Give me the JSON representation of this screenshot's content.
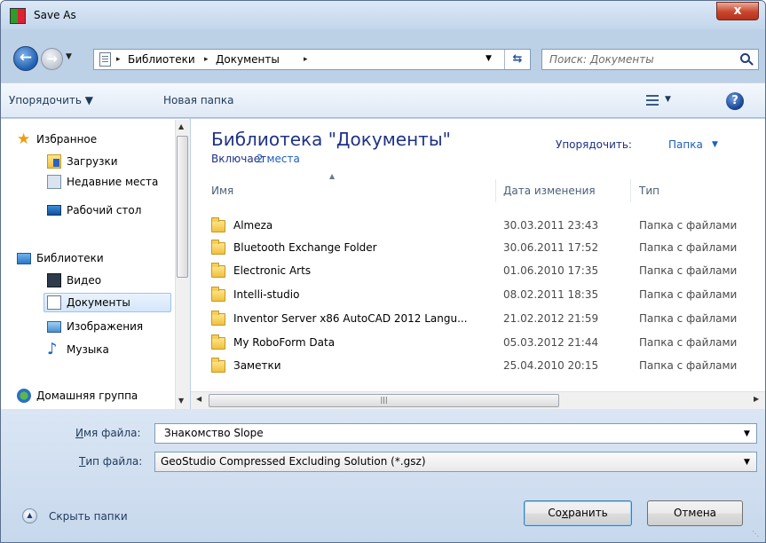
{
  "window": {
    "title": "Save As",
    "close_glyph": "x"
  },
  "address": {
    "crumbs": [
      "Библиотеки",
      "Документы"
    ],
    "sep": "▸",
    "search_placeholder": "Поиск: Документы"
  },
  "toolbar": {
    "organize": "Упорядочить ▼",
    "new_folder": "Новая папка",
    "help": "?"
  },
  "nav": {
    "favorites_header": "Избранное",
    "favorites": [
      "Загрузки",
      "Недавние места",
      "Рабочий стол"
    ],
    "libraries_header": "Библиотеки",
    "libraries": [
      "Видео",
      "Документы",
      "Изображения",
      "Музыка"
    ],
    "homegroup": "Домашняя группа",
    "selected": "Документы"
  },
  "library": {
    "title": "Библиотека \"Документы\"",
    "includes_label": "Включает:",
    "includes_count": "2 места",
    "arrange_label": "Упорядочить:",
    "arrange_value": "Папка"
  },
  "columns": {
    "name": "Имя",
    "date": "Дата изменения",
    "type": "Тип"
  },
  "rows": [
    {
      "name": "Almeza",
      "date": "30.03.2011 23:43",
      "type": "Папка с файлами"
    },
    {
      "name": "Bluetooth Exchange Folder",
      "date": "30.06.2011 17:52",
      "type": "Папка с файлами"
    },
    {
      "name": "Electronic Arts",
      "date": "01.06.2010 17:35",
      "type": "Папка с файлами"
    },
    {
      "name": "Intelli-studio",
      "date": "08.02.2011 18:35",
      "type": "Папка с файлами"
    },
    {
      "name": "Inventor Server x86 AutoCAD 2012 Langu...",
      "date": "21.02.2012 21:59",
      "type": "Папка с файлами"
    },
    {
      "name": "My RoboForm Data",
      "date": "05.03.2012 21:44",
      "type": "Папка с файлами"
    },
    {
      "name": "Заметки",
      "date": "25.04.2010 20:15",
      "type": "Папка с файлами"
    }
  ],
  "form": {
    "filename_label_mn": "И",
    "filename_label_rest": "мя файла:",
    "filename_value": "Знакомство Slope",
    "filetype_label_mn": "Т",
    "filetype_label_rest": "ип файла:",
    "filetype_value": "GeoStudio Compressed Excluding Solution (*.gsz)"
  },
  "footer": {
    "hide_folders": "Скрыть папки",
    "save_pre": "Со",
    "save_mn": "х",
    "save_post": "ранить",
    "cancel": "Отмена"
  }
}
